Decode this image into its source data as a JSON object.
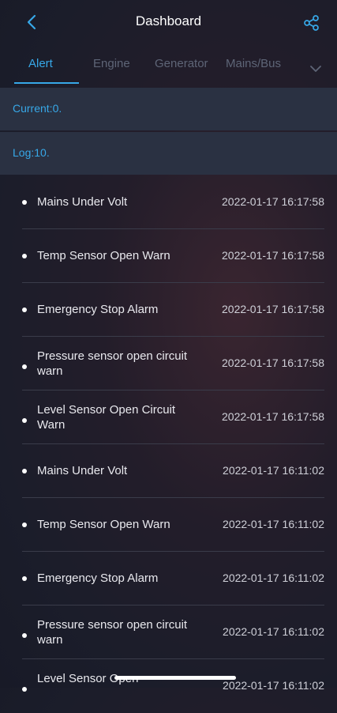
{
  "header": {
    "title": "Dashboard",
    "back_icon": "chevron-left-icon",
    "share_icon": "share-icon"
  },
  "tabs": [
    {
      "label": "Alert",
      "active": true
    },
    {
      "label": "Engine",
      "active": false
    },
    {
      "label": "Generator",
      "active": false
    },
    {
      "label": "Mains/Bus",
      "active": false
    }
  ],
  "tabs_more_icon": "chevron-down-icon",
  "summary": {
    "current": "Current:0.",
    "log": "Log:10."
  },
  "alerts": [
    {
      "label": "Mains Under Volt",
      "time": "2022-01-17 16:17:58"
    },
    {
      "label": "Temp Sensor Open Warn",
      "time": "2022-01-17 16:17:58"
    },
    {
      "label": "Emergency Stop Alarm",
      "time": "2022-01-17 16:17:58"
    },
    {
      "label": "Pressure sensor open circuit warn",
      "time": "2022-01-17 16:17:58"
    },
    {
      "label": "Level Sensor Open Circuit Warn",
      "time": "2022-01-17 16:17:58"
    },
    {
      "label": "Mains Under Volt",
      "time": "2022-01-17 16:11:02"
    },
    {
      "label": "Temp Sensor Open Warn",
      "time": "2022-01-17 16:11:02"
    },
    {
      "label": "Emergency Stop Alarm",
      "time": "2022-01-17 16:11:02"
    },
    {
      "label": "Pressure sensor open circuit warn",
      "time": "2022-01-17 16:11:02"
    },
    {
      "label": "Level Sensor Open",
      "time": "2022-01-17 16:11:02"
    }
  ],
  "colors": {
    "accent": "#37a8e8",
    "strip_bg": "#2a3142",
    "inactive_tab": "#5e6577"
  }
}
